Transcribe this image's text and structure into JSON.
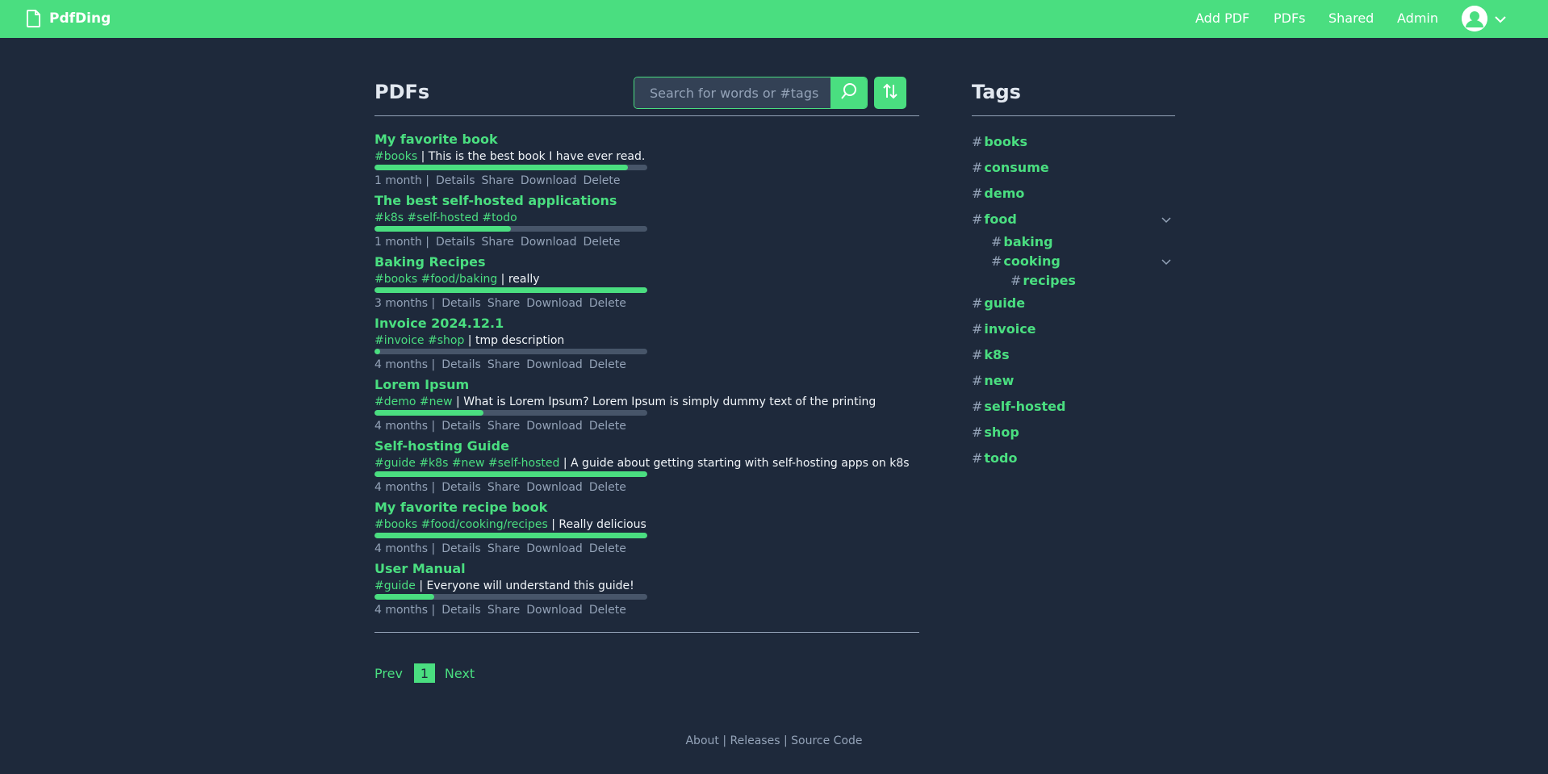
{
  "app": {
    "name": "PdfDing"
  },
  "nav": {
    "add_pdf": "Add PDF",
    "pdfs": "PDFs",
    "shared": "Shared",
    "admin": "Admin"
  },
  "main": {
    "title": "PDFs",
    "search_placeholder": "Search for words or #tags"
  },
  "pdfs": [
    {
      "name": "My favorite book",
      "tags": "#books",
      "sep": " | ",
      "description": "This is the best book I have ever read.",
      "progress": 0.93,
      "age": "1 month |"
    },
    {
      "name": "The best self-hosted applications",
      "tags": "#k8s #self-hosted #todo",
      "sep": "",
      "description": "",
      "progress": 0.5,
      "age": "1 month |"
    },
    {
      "name": "Baking Recipes",
      "tags": "#books #food/baking",
      "sep": " | ",
      "description": "really",
      "progress": 1.0,
      "age": "3 months |"
    },
    {
      "name": "Invoice 2024.12.1",
      "tags": "#invoice #shop",
      "sep": " | ",
      "description": "tmp description",
      "progress": 0.02,
      "age": "4 months |"
    },
    {
      "name": "Lorem Ipsum",
      "tags": "#demo #new",
      "sep": " | ",
      "description": "What is Lorem Ipsum? Lorem Ipsum is simply dummy text of the printing",
      "progress": 0.4,
      "age": "4 months |"
    },
    {
      "name": "Self-hosting Guide",
      "tags": "#guide #k8s #new #self-hosted",
      "sep": " | ",
      "description": "A guide about getting starting with self-hosting apps on k8s",
      "progress": 1.0,
      "age": "4 months |"
    },
    {
      "name": "My favorite recipe book",
      "tags": "#books #food/cooking/recipes",
      "sep": " | ",
      "description": "Really delicious",
      "progress": 1.0,
      "age": "4 months |"
    },
    {
      "name": "User Manual",
      "tags": "#guide",
      "sep": " | ",
      "description": "Everyone will understand this guide!",
      "progress": 0.22,
      "age": "4 months |"
    }
  ],
  "actions": {
    "details": "Details",
    "share": "Share",
    "download": "Download",
    "delete": "Delete"
  },
  "pagination": {
    "prev": "Prev",
    "page": "1",
    "next": "Next"
  },
  "footer": {
    "about": "About",
    "sep1": " | ",
    "releases": "Releases",
    "sep2": " | ",
    "source": "Source Code"
  },
  "tags": {
    "title": "Tags",
    "hash": "#",
    "items": [
      "books",
      "consume",
      "demo",
      "food",
      "baking",
      "cooking",
      "recipes",
      "guide",
      "invoice",
      "k8s",
      "new",
      "self-hosted",
      "shop",
      "todo"
    ]
  },
  "colors": {
    "accent": "#4ade80",
    "background": "#1e293b",
    "muted": "#94a3b8"
  }
}
